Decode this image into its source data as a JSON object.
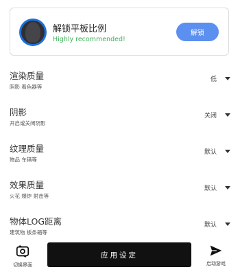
{
  "unlock": {
    "title": "解锁平板比例",
    "subtitle": "Highly recommended!",
    "button_label": "解锁",
    "accent": "#5b8ff0",
    "subtitle_color": "#3fae5a"
  },
  "settings": [
    {
      "title": "渲染质量",
      "desc": "阴影 着色器等",
      "value": "低"
    },
    {
      "title": "阴影",
      "desc": "开启或关闭阴影",
      "value": "关闭"
    },
    {
      "title": "纹理质量",
      "desc": "物品 车辆等",
      "value": "默认"
    },
    {
      "title": "效果质量",
      "desc": "火花 爆炸 射击等",
      "value": "默认"
    },
    {
      "title": "物体LOG距离",
      "desc": "建筑物 板条箱等",
      "value": "默认"
    }
  ],
  "bottom": {
    "switch_label": "切换界面",
    "apply_label": "应用设定",
    "launch_label": "启动游戏"
  },
  "icons": {
    "switch": "camera-rotate-icon",
    "launch": "send-icon",
    "dropdown": "caret-down-icon"
  }
}
